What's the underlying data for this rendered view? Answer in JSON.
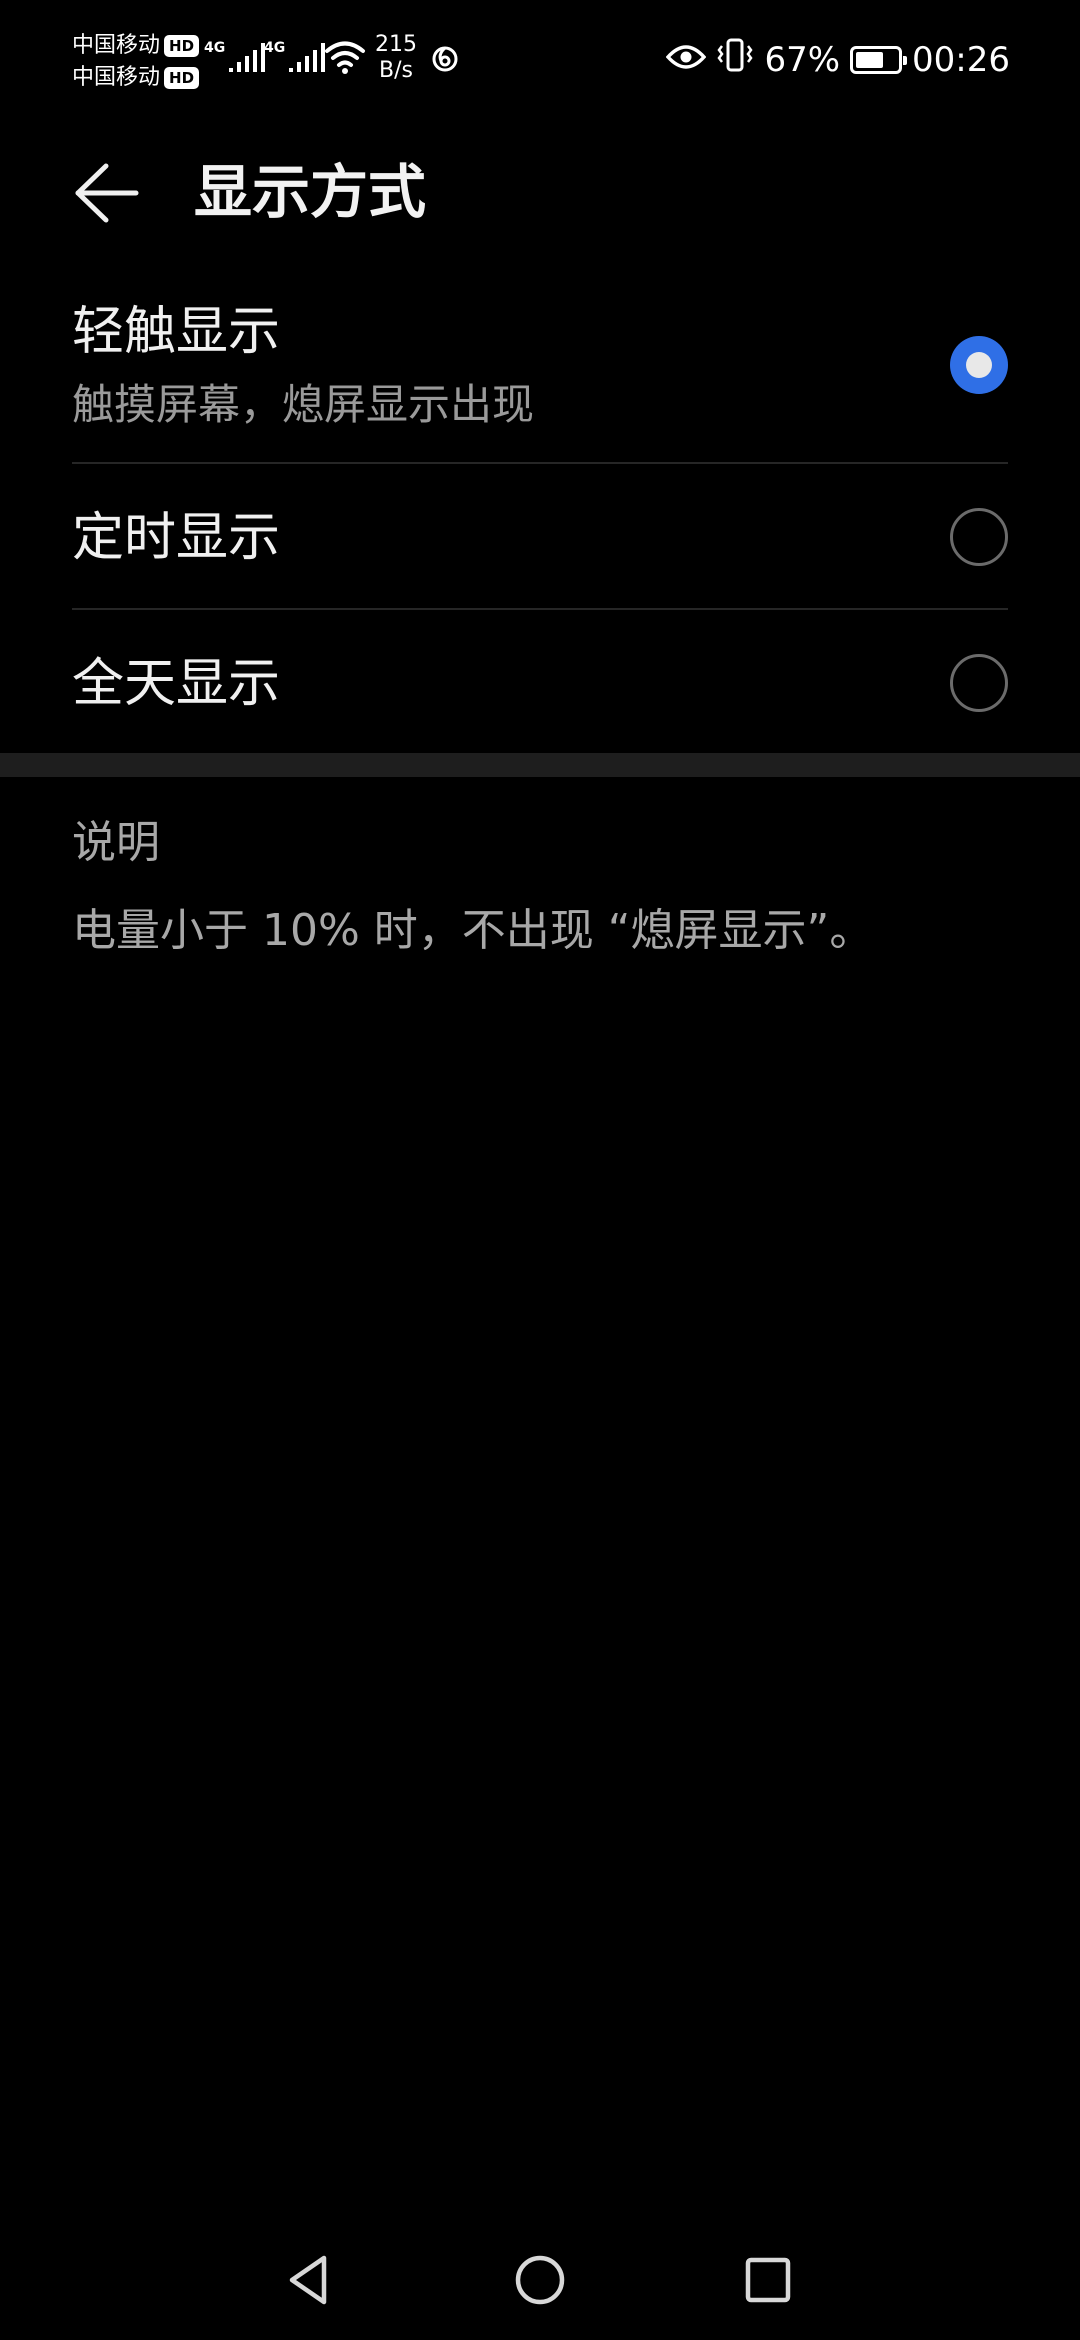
{
  "status_bar": {
    "carrier_1": "中国移动",
    "carrier_2": "中国移动",
    "hd_badge": "HD",
    "network_gen": "4G",
    "net_speed_value": "215",
    "net_speed_unit": "B/s",
    "battery_percent": "67%",
    "battery_level": 0.67,
    "time": "00:26",
    "icons": [
      "signal-icon",
      "wifi-icon",
      "swirl-icon",
      "eye-icon",
      "vibrate-icon",
      "battery-icon"
    ]
  },
  "header": {
    "title": "显示方式",
    "back_icon": "back-arrow-icon"
  },
  "options": [
    {
      "title": "轻触显示",
      "subtitle": "触摸屏幕，熄屏显示出现",
      "selected": true
    },
    {
      "title": "定时显示",
      "selected": false
    },
    {
      "title": "全天显示",
      "selected": false
    }
  ],
  "note": {
    "heading": "说明",
    "text": "电量小于 10% 时，不出现 “熄屏显示”。"
  },
  "colors": {
    "accent": "#2f6fe6",
    "background": "#000000",
    "secondary_text": "#9a9a9a"
  },
  "nav_bar": {
    "icons": [
      "nav-back-icon",
      "nav-home-icon",
      "nav-recent-icon"
    ]
  }
}
